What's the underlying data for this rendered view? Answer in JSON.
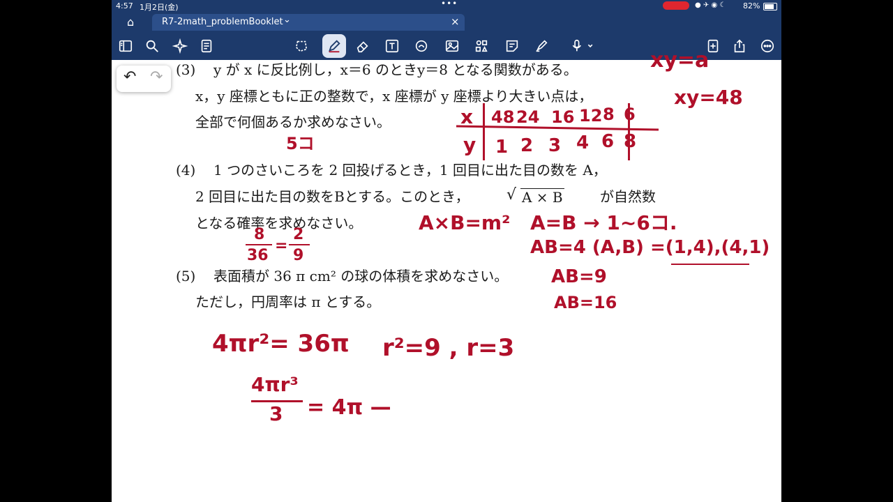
{
  "status": {
    "time": "4:57",
    "date": "1月2日(金)",
    "battery": "82%"
  },
  "tab": {
    "title": "R7-2math_problemBooklet",
    "chevron": "⌄",
    "close": "×",
    "home": "⌂"
  },
  "toolbar": {
    "icons": [
      "sidebar-icon",
      "search-icon",
      "sparkle-icon",
      "document-icon",
      "lasso-icon",
      "pen-icon",
      "eraser-icon",
      "text-icon",
      "shapes-icon",
      "image-icon",
      "elements-icon",
      "sticky-note-icon",
      "highlighter-icon",
      "audio-icon",
      "add-page-icon",
      "share-icon",
      "more-icon"
    ],
    "accent": "#1d3a6b"
  },
  "problem3": {
    "num": "(3)",
    "line1": "y が x に反比例し，x＝6 のときy＝8 となる関数がある。",
    "line2": "x，y 座標ともに正の整数で，x 座標が y 座標より大きい点は，",
    "line3": "全部で何個あるか求めなさい。"
  },
  "problem4": {
    "num": "(4)",
    "line1": "1 つのさいころを 2 回投げるとき，1 回目に出た目の数を A，",
    "line2a": "2 回目に出た目の数をBとする。このとき，",
    "sqrt": "A × B",
    "line2b": "が自然数",
    "line3": "となる確率を求めなさい。"
  },
  "problem5": {
    "num": "(5)",
    "line1": "表面積が 36 π cm² の球の体積を求めなさい。",
    "line2": "ただし，円周率は π とする。"
  },
  "notes": {
    "xy_a": "xy=a",
    "xy_48": "xy=48",
    "table_x_label": "x",
    "table_y_label": "y",
    "table_x": [
      "48",
      "24",
      "16",
      "12",
      "8",
      "6"
    ],
    "table_y": [
      "1",
      "2",
      "3",
      "4",
      "6",
      "8"
    ],
    "answer3": "5コ",
    "axb": "A×B=m²",
    "a_eq_b": "A=B → 1~6コ.",
    "ab4": "AB=4 (A,B) =(1,4),(4,1)",
    "ab9": "AB=9",
    "ab16": "AB=16",
    "frac_left_num": "8",
    "frac_left_den": "36",
    "frac_right_num": "2",
    "frac_right_den": "9",
    "eq_sign": "=",
    "surface": "4πr²= 36π",
    "r_sq": "r²=9 , r=3",
    "vol_num": "4πr³",
    "vol_den": "3",
    "vol_rhs": "= 4π —",
    "ink_color": "#b0102a"
  },
  "undo": {
    "undo_icon": "↶",
    "redo_icon": "↷"
  }
}
